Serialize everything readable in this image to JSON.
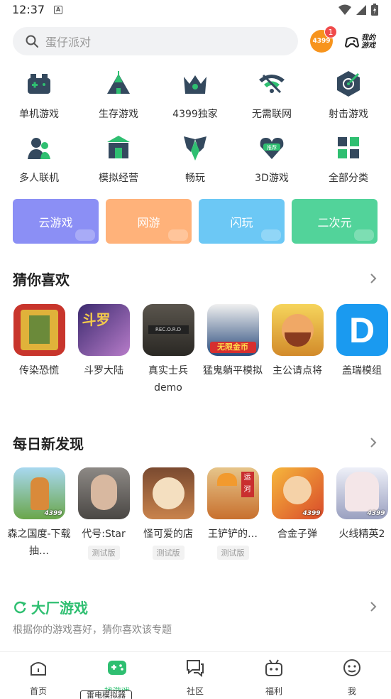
{
  "status_bar": {
    "time": "12:37",
    "indicator": "A"
  },
  "search": {
    "placeholder": "蛋仔派对"
  },
  "header": {
    "badge_brand": "4399",
    "badge_count": "1",
    "my_games_line1": "我的",
    "my_games_line2": "游戏"
  },
  "categories": [
    {
      "label": "单机游戏",
      "icon": "gamepad-icon"
    },
    {
      "label": "生存游戏",
      "icon": "tent-icon"
    },
    {
      "label": "4399独家",
      "icon": "crown-icon"
    },
    {
      "label": "无需联网",
      "icon": "no-wifi-icon"
    },
    {
      "label": "射击游戏",
      "icon": "target-icon"
    },
    {
      "label": "多人联机",
      "icon": "multiplayer-icon"
    },
    {
      "label": "模拟经营",
      "icon": "building-icon"
    },
    {
      "label": "畅玩",
      "icon": "wings-icon"
    },
    {
      "label": "3D游戏",
      "icon": "heart-recommend-icon",
      "icon_text": "推荐"
    },
    {
      "label": "全部分类",
      "icon": "grid-icon"
    }
  ],
  "tiles": [
    {
      "label": "云游戏",
      "color": "#8b8ff5"
    },
    {
      "label": "网游",
      "color": "#ffb27a"
    },
    {
      "label": "闪玩",
      "color": "#6cc8f5"
    },
    {
      "label": "二次元",
      "color": "#52d39a"
    }
  ],
  "guess": {
    "title": "猜你喜欢",
    "games": [
      {
        "name": "传染恐慌",
        "icon_color": "#c8352c"
      },
      {
        "name": "斗罗大陆",
        "icon_color": "#5d3e9c",
        "icon_text": "斗罗"
      },
      {
        "name": "真实士兵demo",
        "icon_color": "#3c3a36",
        "icon_text": "REC.O.R.D"
      },
      {
        "name": "猛鬼躺平模拟",
        "icon_color": "#2a4b7c",
        "icon_text": "无限金币"
      },
      {
        "name": "主公请点将",
        "icon_color": "#d9a23a"
      },
      {
        "name": "盖瑞模组",
        "icon_color": "#1a9af0",
        "icon_text": "D"
      }
    ]
  },
  "daily": {
    "title": "每日新发现",
    "games": [
      {
        "name": "森之国度-下载抽…",
        "icon_color": "#6fb3d6",
        "corner": "4399"
      },
      {
        "name": "代号:Star",
        "icon_color": "#7d7a78",
        "tag": "测试版"
      },
      {
        "name": "怪可爱的店",
        "icon_color": "#a95f3e",
        "tag": "测试版"
      },
      {
        "name": "王铲铲的…",
        "icon_color": "#c8702e",
        "tag": "测试版",
        "icon_text": "运河"
      },
      {
        "name": "合金子弹",
        "icon_color": "#e0a12c",
        "corner": "4399"
      },
      {
        "name": "火线精英2",
        "icon_color": "#d9dbe8",
        "corner": "4399"
      }
    ]
  },
  "big_factory": {
    "title": "大厂游戏",
    "subtitle": "根据你的游戏喜好，猜你喜欢该专题"
  },
  "bottom_nav": [
    {
      "label": "首页",
      "icon": "home-icon"
    },
    {
      "label": "找游戏",
      "icon": "find-game-icon",
      "active": true
    },
    {
      "label": "社区",
      "icon": "community-icon"
    },
    {
      "label": "福利",
      "icon": "gift-icon"
    },
    {
      "label": "我",
      "icon": "profile-icon"
    }
  ],
  "tooltip": "雷电模拟器",
  "accent_color": "#2fbf71"
}
